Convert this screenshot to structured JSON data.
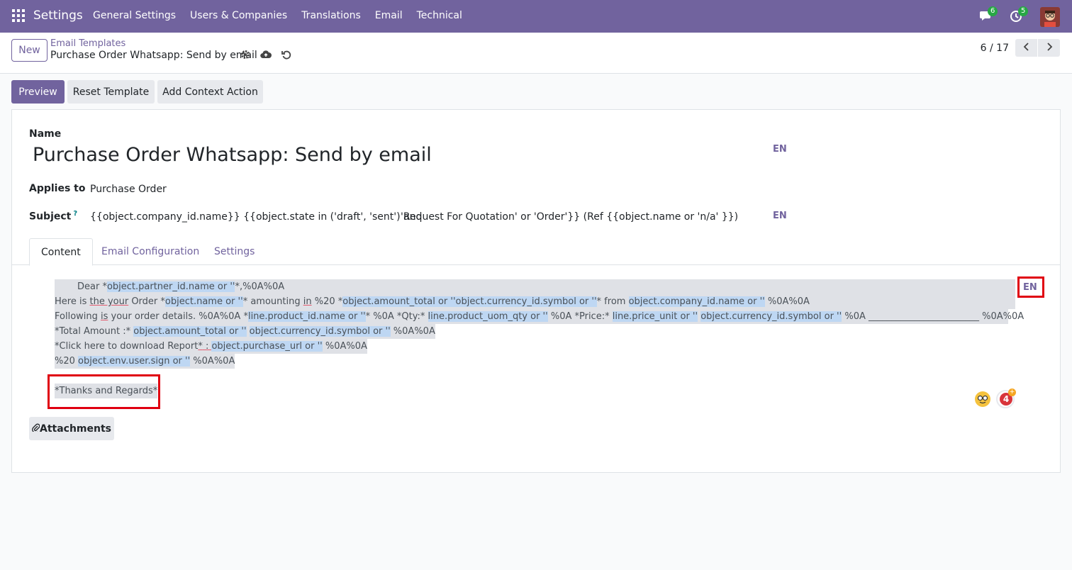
{
  "navbar": {
    "brand": "Settings",
    "menu": [
      "General Settings",
      "Users & Companies",
      "Translations",
      "Email",
      "Technical"
    ],
    "chat_count": "6",
    "activity_count": "5"
  },
  "control_panel": {
    "new_label": "New",
    "breadcrumb_parent": "Email Templates",
    "breadcrumb_current": "Purchase Order Whatsapp: Send by email",
    "pager": "6 / 17"
  },
  "actions": {
    "preview": "Preview",
    "reset": "Reset Template",
    "context": "Add Context Action"
  },
  "form": {
    "name_label": "Name",
    "name_value": "Purchase Order Whatsapp: Send by email",
    "lang": "EN",
    "applies_label": "Applies to",
    "applies_value": "Purchase Order",
    "subject_label": "Subject",
    "subject_help": "?",
    "subject_value_a": "{{object.company_id.name}} {{object.state in ('draft', 'sent') and",
    "subject_value_b": "'Request For Quotation' or 'Order'}} (Ref {{object.name or 'n/a' }})",
    "tabs": [
      "Content",
      "Email Configuration",
      "Settings"
    ],
    "attachments": "Attachments"
  },
  "editor": {
    "l1": {
      "a": "Dear *",
      "b": "object.partner_id.name or ''",
      "c": "*,%0A%0A"
    },
    "l2": {
      "a": "Here is ",
      "b": "the your",
      "c": " Order *",
      "d": "object.name or ''",
      "e": "* amounting ",
      "f": "in",
      "g": " %20 *",
      "h": "object.amount_total or ''",
      "i": "object.currency_id.symbol or ''",
      "j": "* from ",
      "k": "object.company_id.name or ''",
      "l": " %0A%0A"
    },
    "l3": {
      "a": "Following ",
      "b": "is",
      "c": " your order details. %0A%0A *",
      "d": "line.product_id.name or ''",
      "e": "* %0A *Qty:* ",
      "f": "line.product_uom_qty or ''",
      "g": " %0A *Price:* ",
      "h": "line.price_unit or ''",
      "i": " ",
      "j": "object.currency_id.symbol or ''",
      "k": " %0A ________________________ %0A%0A"
    },
    "l4": {
      "a": "*Total Amount :* ",
      "b": "object.amount_total or ''",
      "c": " ",
      "d": "object.currency_id.symbol or ''",
      "e": " %0A%0A"
    },
    "l5": {
      "a": "*Click here to download Report",
      "b": "*",
      "c": " : ",
      "d": "object.purchase_url or ''",
      "e": " %0A%0A"
    },
    "l6": {
      "a": "%20 ",
      "b": "object.env.user.sign or ''",
      "c": " %0A%0A"
    },
    "l7": "*Thanks and Regards*",
    "grammar_count": "4"
  }
}
